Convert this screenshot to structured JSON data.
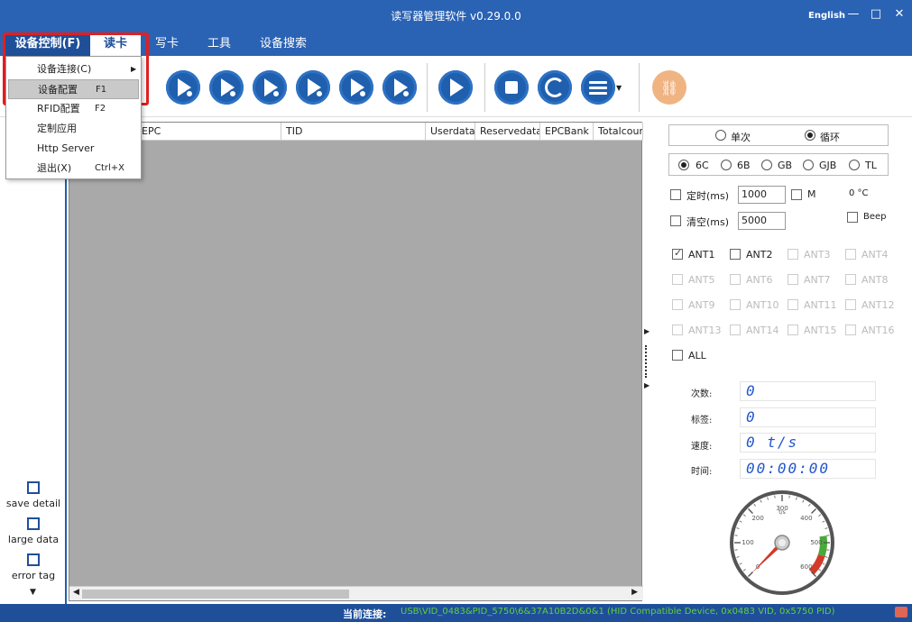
{
  "window": {
    "title": "读写器管理软件 v0.29.0.0",
    "language": "English",
    "minimize_glyph": "—",
    "maximize_glyph": "□",
    "close_glyph": "✕"
  },
  "menubar": {
    "device_control": "设备控制(F)",
    "read_card": "读卡",
    "write_card": "写卡",
    "tools": "工具",
    "device_search": "设备搜索"
  },
  "dropdown": {
    "items": [
      {
        "label": "设备连接(C)",
        "shortcut": "",
        "submenu": true
      },
      {
        "label": "设备配置",
        "shortcut": "F1",
        "submenu": false,
        "highlighted": true
      },
      {
        "label": "RFID配置",
        "shortcut": "F2",
        "submenu": false
      },
      {
        "label": "定制应用",
        "shortcut": "",
        "submenu": false
      },
      {
        "label": "Http Server",
        "shortcut": "",
        "submenu": false
      },
      {
        "label": "退出(X)",
        "shortcut": "Ctrl+X",
        "submenu": false
      }
    ]
  },
  "table": {
    "columns": [
      "EPC",
      "TID",
      "Userdata",
      "Reservedata",
      "EPCBank",
      "Totalcour"
    ]
  },
  "left_panel": {
    "save_detail": "save detail",
    "large_data": "large data",
    "error_tag": "error tag"
  },
  "right_panel": {
    "mode_single": "单次",
    "mode_loop": "循环",
    "protocols": [
      "6C",
      "6B",
      "GB",
      "GJB",
      "TL"
    ],
    "timer_label": "定时(ms)",
    "timer_value": "1000",
    "m_label": "M",
    "temperature": "0 °C",
    "clear_label": "清空(ms)",
    "clear_value": "5000",
    "beep_label": "Beep",
    "antennas": [
      "ANT1",
      "ANT2",
      "ANT3",
      "ANT4",
      "ANT5",
      "ANT6",
      "ANT7",
      "ANT8",
      "ANT9",
      "ANT10",
      "ANT11",
      "ANT12",
      "ANT13",
      "ANT14",
      "ANT15",
      "ANT16"
    ],
    "all_label": "ALL",
    "stats": {
      "count_label": "次数:",
      "count_value": "0",
      "tags_label": "标签:",
      "tags_value": "0",
      "speed_label": "速度:",
      "speed_value": "0  t/s",
      "time_label": "时间:",
      "time_value": "00:00:00"
    },
    "gauge": {
      "ticks": [
        "0",
        "100",
        "200",
        "300",
        "400",
        "500",
        "600"
      ],
      "unit": "t/s",
      "value": 0
    }
  },
  "statusbar": {
    "label": "当前连接:",
    "value": "USB\\VID_0483&PID_5750\\6&37A10B2D&0&1 (HID Compatible Device, 0x0483 VID, 0x5750 PID)"
  },
  "colors": {
    "title_bar": "#2a62b4",
    "accent": "#1f5fae",
    "highlight_red": "#e02020"
  }
}
